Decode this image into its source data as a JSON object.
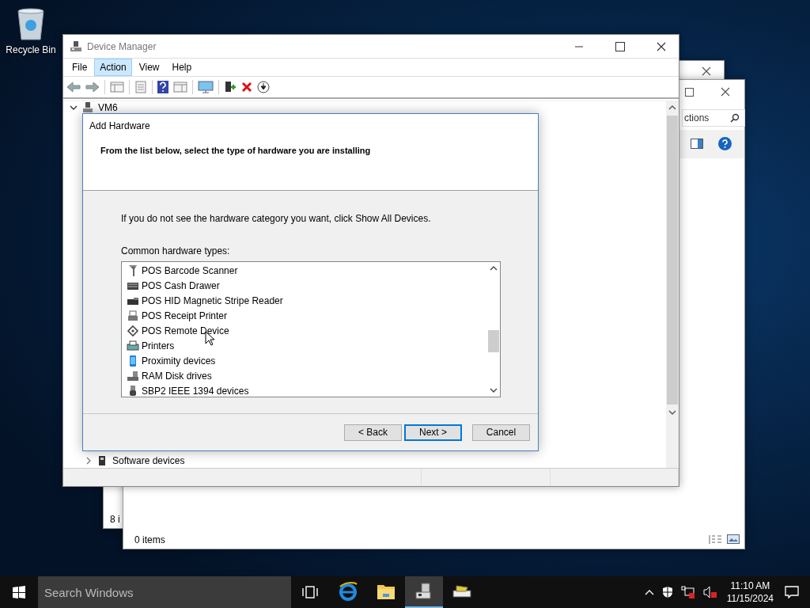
{
  "desktop_icons": [
    {
      "label": "Recycle Bin"
    }
  ],
  "background_windows": [
    {
      "status": "8 i"
    },
    {
      "search": {
        "value": "ctions"
      },
      "status": "0 items"
    }
  ],
  "device_manager": {
    "title": "Device Manager",
    "menu": [
      {
        "label": "File",
        "selected": false
      },
      {
        "label": "Action",
        "selected": true
      },
      {
        "label": "View",
        "selected": false
      },
      {
        "label": "Help",
        "selected": false
      }
    ],
    "tree": {
      "label": "VM6",
      "expanded": true,
      "children": [
        {
          "label": "Software devices"
        }
      ]
    }
  },
  "dialog": {
    "title": "Add Hardware",
    "heading": "From the list below, select the type of hardware you are installing",
    "instruction": "If you do not see the hardware category you want, click Show All Devices.",
    "list_label": "Common hardware types:",
    "items": [
      {
        "label": "POS Barcode Scanner",
        "selected": false
      },
      {
        "label": "POS Cash Drawer",
        "selected": false
      },
      {
        "label": "POS HID Magnetic Stripe Reader",
        "selected": false
      },
      {
        "label": "POS Receipt Printer",
        "selected": false
      },
      {
        "label": "POS Remote Device",
        "selected": false
      },
      {
        "label": "Printers",
        "selected": false
      },
      {
        "label": "Proximity devices",
        "selected": false
      },
      {
        "label": "RAM Disk drives",
        "selected": false
      },
      {
        "label": "SBP2 IEEE 1394 devices",
        "selected": false
      }
    ],
    "buttons": [
      {
        "label": "< Back",
        "default": false
      },
      {
        "label": "Next >",
        "default": true
      },
      {
        "label": "Cancel",
        "default": false
      }
    ]
  },
  "taskbar": {
    "search": {
      "placeholder": "Search Windows"
    },
    "apps": [
      {
        "kind": "browser",
        "selected": false
      },
      {
        "kind": "folder",
        "selected": false
      },
      {
        "kind": "device-manager",
        "selected": true
      },
      {
        "kind": "hardware",
        "selected": false
      }
    ],
    "clock": {
      "time": "11:10 AM",
      "date": "11/15/2024"
    }
  }
}
